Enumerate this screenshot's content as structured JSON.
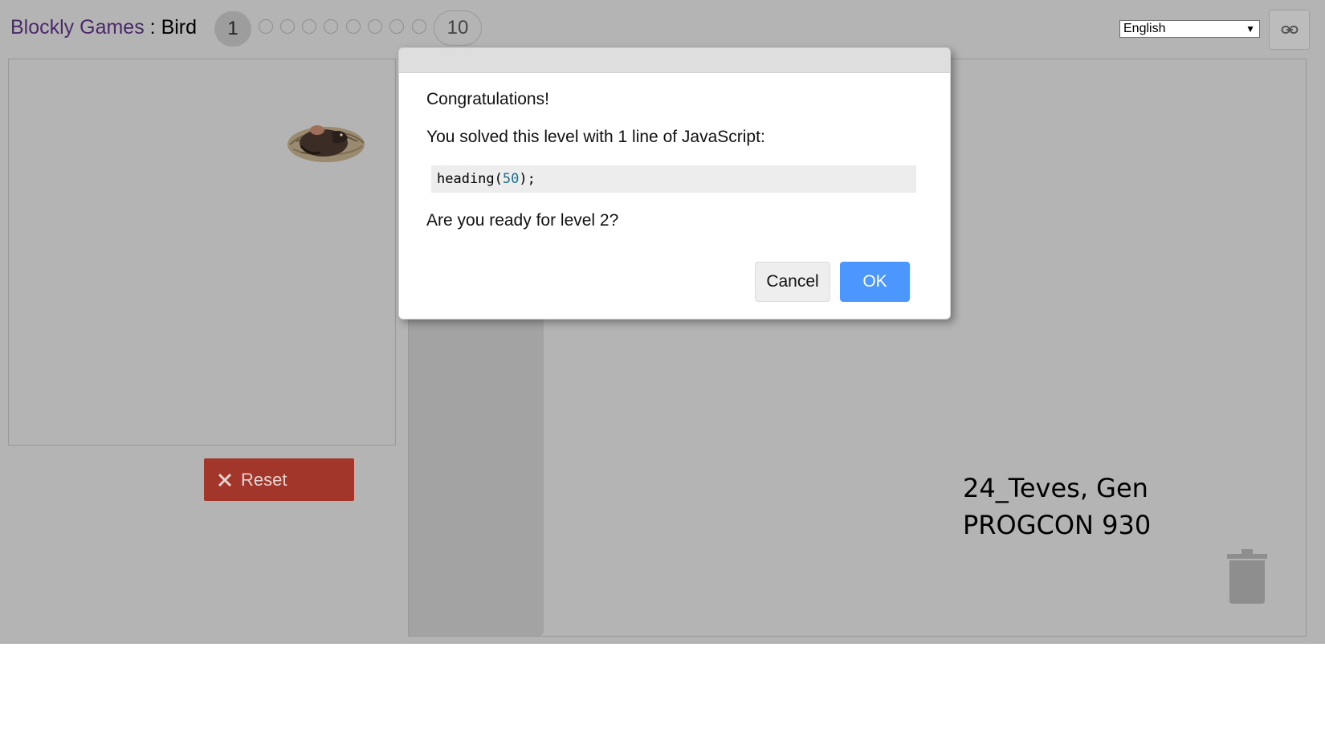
{
  "header": {
    "brand": "Blockly Games",
    "separator": ":",
    "game": "Bird",
    "current_level": "1",
    "last_level": "10"
  },
  "language": {
    "selected": "English"
  },
  "icons": {
    "link": "link-icon",
    "reset": "close-icon",
    "trash": "trash-icon",
    "bird": "bird-nest-image"
  },
  "reset": {
    "label": "Reset"
  },
  "dialog": {
    "congrats": "Congratulations!",
    "solved": "You solved this level with 1 line of JavaScript:",
    "code_fn": "heading(",
    "code_arg": "50",
    "code_end": ");",
    "question": "Are you ready for level 2?",
    "cancel": "Cancel",
    "ok": "OK"
  },
  "watermark": {
    "line1": "24_Teves, Gen",
    "line2": "PROGCON 930"
  },
  "colors": {
    "background": "#b4b4b4",
    "reset": "#a2362a",
    "ok": "#4c97ff",
    "toolbox": "#a3a3a3"
  }
}
